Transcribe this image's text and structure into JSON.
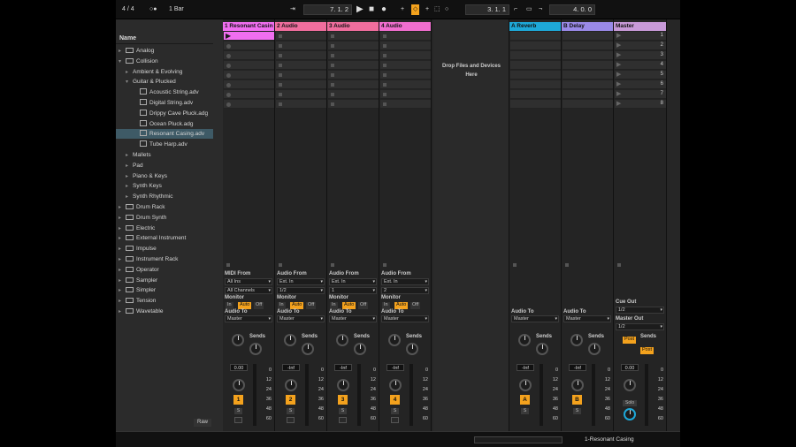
{
  "topbar": {
    "sig": "4 / 4",
    "ind": "1 Bar",
    "pos": "7.  1.  2",
    "loop": "3.  1.  1",
    "len": "4.  0.  0"
  },
  "browser": {
    "header": "Name",
    "items": [
      {
        "label": "Analog",
        "level": 0,
        "type": "folder",
        "arrow": "▸"
      },
      {
        "label": "Collision",
        "level": 0,
        "type": "folder",
        "arrow": "▾"
      },
      {
        "label": "Ambient & Evolving",
        "level": 1,
        "type": "none",
        "arrow": "▸"
      },
      {
        "label": "Guitar & Plucked",
        "level": 1,
        "type": "none",
        "arrow": "▾"
      },
      {
        "label": "Acoustic String.adv",
        "level": 2,
        "type": "adv",
        "arrow": ""
      },
      {
        "label": "Digital String.adv",
        "level": 2,
        "type": "adv",
        "arrow": ""
      },
      {
        "label": "Drippy Cave Pluck.adg",
        "level": 2,
        "type": "adv",
        "arrow": ""
      },
      {
        "label": "Ocean Pluck.adg",
        "level": 2,
        "type": "adv",
        "arrow": ""
      },
      {
        "label": "Resonant Casing.adv",
        "level": 2,
        "type": "adv",
        "arrow": "",
        "selected": true
      },
      {
        "label": "Tube Harp.adv",
        "level": 2,
        "type": "adv",
        "arrow": ""
      },
      {
        "label": "Mallets",
        "level": 1,
        "type": "none",
        "arrow": "▸"
      },
      {
        "label": "Pad",
        "level": 1,
        "type": "none",
        "arrow": "▸"
      },
      {
        "label": "Piano & Keys",
        "level": 1,
        "type": "none",
        "arrow": "▸"
      },
      {
        "label": "Synth Keys",
        "level": 1,
        "type": "none",
        "arrow": "▸"
      },
      {
        "label": "Synth Rhythmic",
        "level": 1,
        "type": "none",
        "arrow": "▸"
      },
      {
        "label": "Drum Rack",
        "level": 0,
        "type": "folder",
        "arrow": "▸"
      },
      {
        "label": "Drum Synth",
        "level": 0,
        "type": "folder",
        "arrow": "▸"
      },
      {
        "label": "Electric",
        "level": 0,
        "type": "folder",
        "arrow": "▸"
      },
      {
        "label": "External Instrument",
        "level": 0,
        "type": "folder",
        "arrow": "▸"
      },
      {
        "label": "Impulse",
        "level": 0,
        "type": "folder",
        "arrow": "▸"
      },
      {
        "label": "Instrument Rack",
        "level": 0,
        "type": "folder",
        "arrow": "▸"
      },
      {
        "label": "Operator",
        "level": 0,
        "type": "folder",
        "arrow": "▸"
      },
      {
        "label": "Sampler",
        "level": 0,
        "type": "folder",
        "arrow": "▸"
      },
      {
        "label": "Simpler",
        "level": 0,
        "type": "folder",
        "arrow": "▸"
      },
      {
        "label": "Tension",
        "level": 0,
        "type": "folder",
        "arrow": "▸"
      },
      {
        "label": "Wavetable",
        "level": 0,
        "type": "folder",
        "arrow": "▸"
      }
    ],
    "raw": "Raw"
  },
  "drop": {
    "line1": "Drop Files and Devices",
    "line2": "Here"
  },
  "tracks": [
    {
      "name": "1 Resonant Casin",
      "color": "#f06ef0",
      "from": "MIDI From",
      "src": "All Ins",
      "ch": "All Channels",
      "vol": "0.00",
      "num": "1",
      "midi": true
    },
    {
      "name": "2 Audio",
      "color": "#f06e9e",
      "from": "Audio From",
      "src": "Ext. In",
      "ch": "1/2",
      "vol": "-Inf",
      "num": "2"
    },
    {
      "name": "3 Audio",
      "color": "#f06e9e",
      "from": "Audio From",
      "src": "Ext. In",
      "ch": "1",
      "vol": "-Inf",
      "num": "3"
    },
    {
      "name": "4 Audio",
      "color": "#f06ecf",
      "from": "Audio From",
      "src": "Ext. In",
      "ch": "2",
      "vol": "-Inf",
      "num": "4"
    }
  ],
  "returns": [
    {
      "name": "A Reverb",
      "color": "#1ea8d8",
      "vol": "-Inf",
      "num": "A"
    },
    {
      "name": "B Delay",
      "color": "#9a8ae8",
      "vol": "-Inf",
      "num": "B"
    }
  ],
  "master": {
    "name": "Master",
    "color": "#c89ad8",
    "cue": "Cue Out",
    "cue_val": "1/2",
    "mout": "Master Out",
    "mout_val": "1/2",
    "vol": "0.00",
    "solo": "Solo",
    "post": "Post"
  },
  "labels": {
    "monitor": "Monitor",
    "in": "In",
    "auto": "Auto",
    "off": "Off",
    "audio_to": "Audio To",
    "master": "Master",
    "sends": "Sends",
    "a": "A",
    "b": "B",
    "s": "S"
  },
  "scale": [
    "0",
    "12",
    "24",
    "36",
    "48",
    "60"
  ],
  "clip_nums": [
    "7",
    "4"
  ],
  "scenes": [
    "1",
    "2",
    "3",
    "4",
    "5",
    "6",
    "7",
    "8"
  ],
  "status": {
    "track": "1-Resonant Casing"
  }
}
